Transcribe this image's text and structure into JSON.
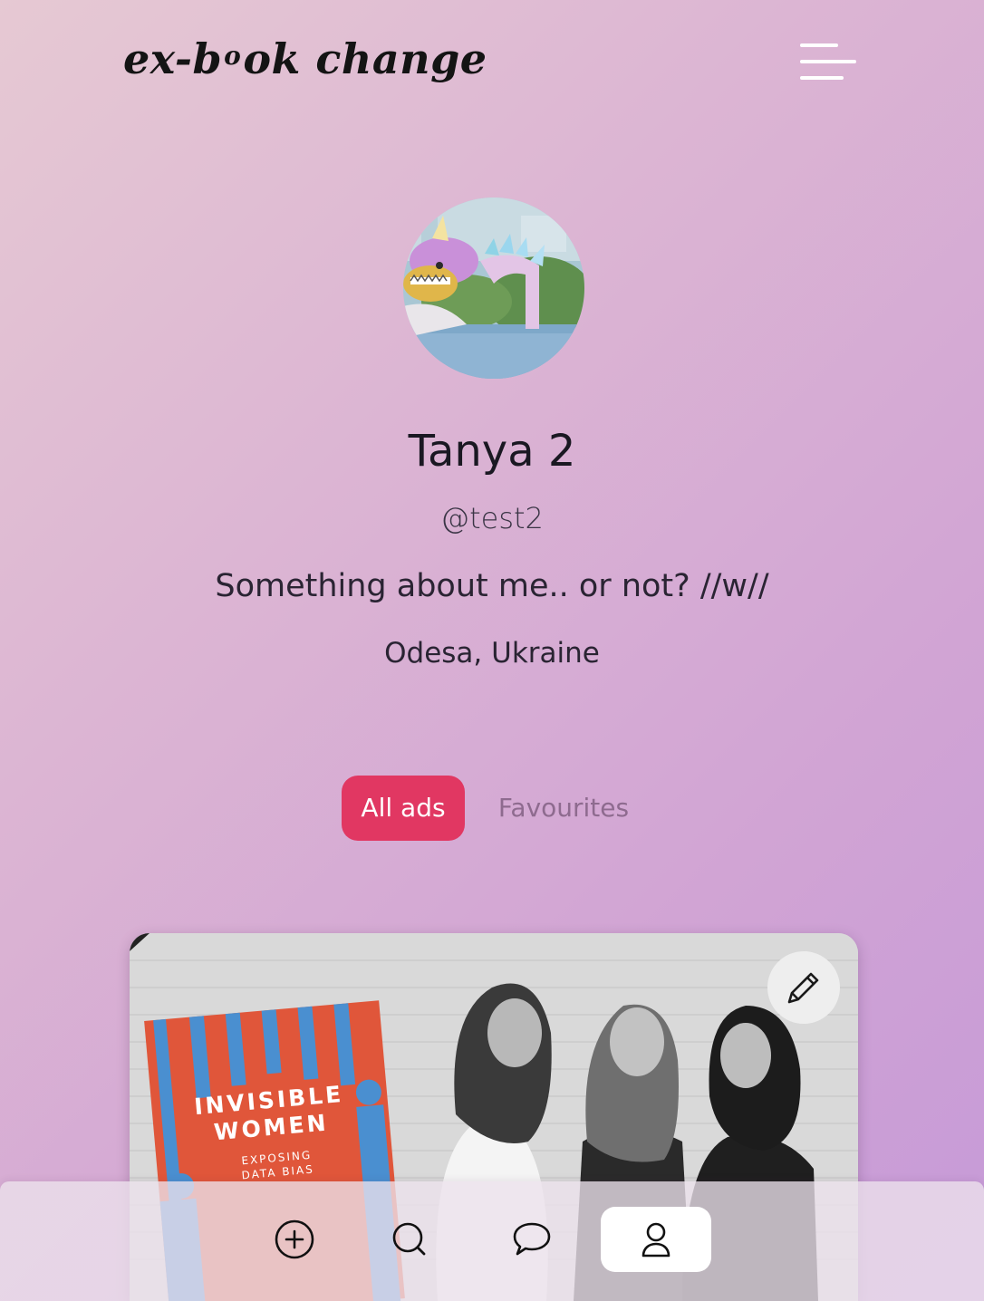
{
  "header": {
    "logo_prefix": "ex-b",
    "logo_sup": "o",
    "logo_suffix": "ok change",
    "menu_icon": "hamburger-menu-icon"
  },
  "profile": {
    "avatar_icon": "dragon-avatar-photo",
    "name": "Tanya 2",
    "handle": "@test2",
    "bio": "Something about me.. or not? //w//",
    "location": "Odesa, Ukraine"
  },
  "tabs": [
    {
      "label": "All ads",
      "active": true
    },
    {
      "label": "Favourites",
      "active": false
    }
  ],
  "ad_card": {
    "image_description_icon": "book-cover-photo",
    "book_title_line1": "INVISIBLE",
    "book_title_line2": "WOMEN",
    "book_subtitle_line1": "EXPOSING",
    "book_subtitle_line2": "DATA BIAS",
    "edit_icon": "pencil-icon"
  },
  "bottom_nav": {
    "items": [
      {
        "icon": "plus-circle-icon",
        "active": false
      },
      {
        "icon": "search-icon",
        "active": false
      },
      {
        "icon": "chat-bubble-icon",
        "active": false
      },
      {
        "icon": "user-icon",
        "active": true
      }
    ]
  },
  "colors": {
    "accent": "#e13762",
    "background_start": "#e6c9d3",
    "background_end": "#c69ad8",
    "inactive_tab_text": "#8e6b8f"
  }
}
